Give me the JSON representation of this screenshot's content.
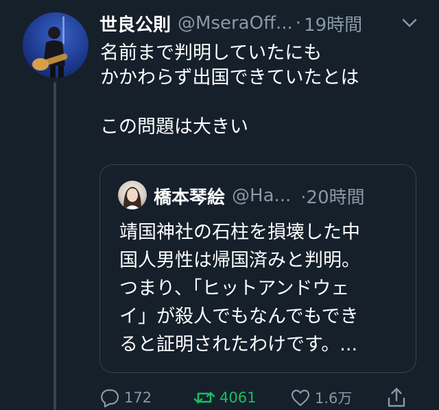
{
  "tweet": {
    "author_name": "世良公則",
    "author_handle": "@MseraOff...",
    "separator": "·",
    "timestamp": "19時間",
    "body": "名前まで判明していたにも\nかかわらず出国できていたとは\n\nこの問題は大きい"
  },
  "quoted_tweet": {
    "author_name": "橋本琴絵",
    "author_handle": "@Ha...",
    "timestamp": "·20時間",
    "body": "靖国神社の石柱を損壊した中\n国人男性は帰国済みと判明。\nつまり、「ヒットアンドウェ\nイ」が殺人でもなんでもでき\nると証明されたわけです。..."
  },
  "actions": {
    "reply_count": "172",
    "retweet_count": "4061",
    "like_count": "1.6万"
  },
  "icons": {
    "more": "chevron-down-icon",
    "reply": "comment-icon",
    "retweet": "retweet-icon",
    "like": "heart-icon",
    "share": "share-icon"
  },
  "colors": {
    "background": "#15202b",
    "text_primary": "#ffffff",
    "text_secondary": "#8899a6",
    "border": "#38444d",
    "retweet_active": "#17bf63"
  }
}
